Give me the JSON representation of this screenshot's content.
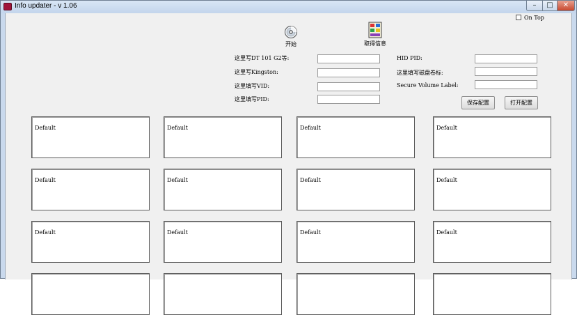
{
  "window": {
    "title": "Info updater - v 1.06"
  },
  "controls": {
    "minimize": "–",
    "maximize": "□",
    "close": "✕"
  },
  "on_top": {
    "label": "On Top",
    "checked": false
  },
  "toolbar": {
    "start": {
      "label": "开始",
      "icon": "cd-disc-icon"
    },
    "get_info": {
      "label": "取得信息",
      "icon": "info-card-icon"
    }
  },
  "left_form": [
    {
      "label": "这里写DT 101 G2等:",
      "value": ""
    },
    {
      "label": "这里写Kingston:",
      "value": ""
    },
    {
      "label": "这里填写VID:",
      "value": ""
    },
    {
      "label": "这里填写PID:",
      "value": ""
    }
  ],
  "right_form": [
    {
      "label": "HID PID:",
      "value": ""
    },
    {
      "label": "这里填写磁盘卷标:",
      "value": ""
    },
    {
      "label": "Secure Volume Label:",
      "value": ""
    }
  ],
  "buttons": {
    "save_config": "保存配置",
    "open_config": "打开配置"
  },
  "panels": [
    "Default",
    "Default",
    "Default",
    "Default",
    "Default",
    "Default",
    "Default",
    "Default",
    "Default",
    "Default",
    "Default",
    "Default",
    "",
    "",
    "",
    ""
  ]
}
